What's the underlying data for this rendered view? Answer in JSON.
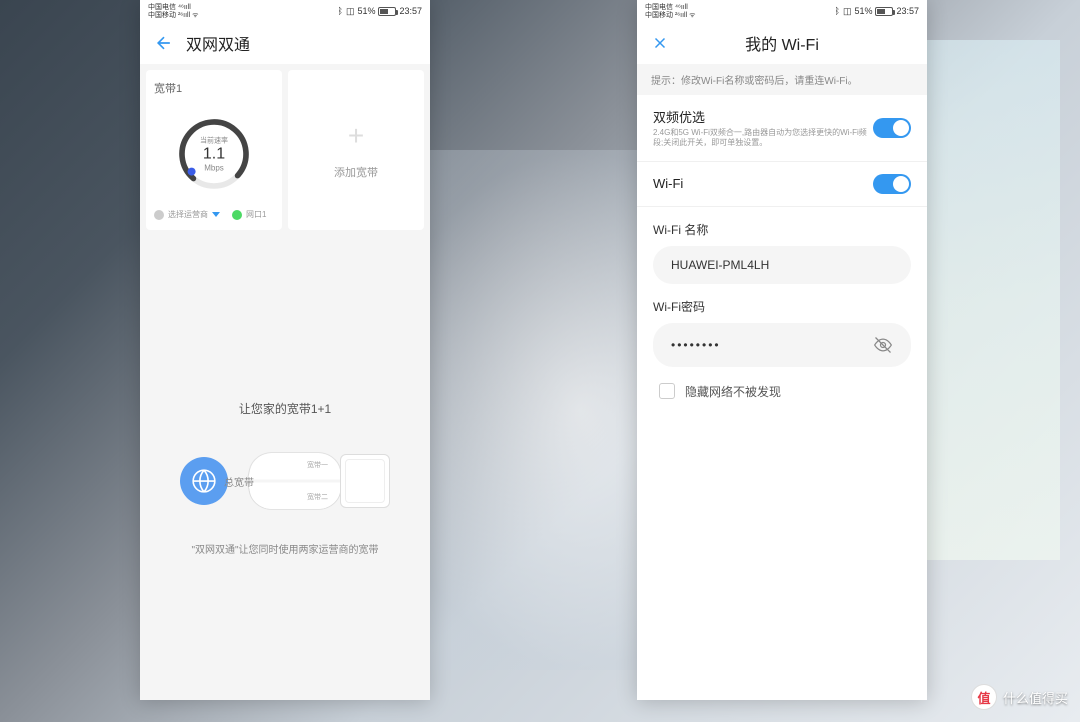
{
  "status": {
    "carrier1": "中国电信 ⁴⁶ııll",
    "carrier2": "中国移动 ²⁶ııll ᯤ",
    "bluetooth": "ᛒ",
    "vibrate": "◫",
    "battery": "51%",
    "time": "23:57"
  },
  "left": {
    "title": "双网双通",
    "card1": {
      "title": "宽带1",
      "gauge_label": "当前速率",
      "gauge_value": "1.1",
      "gauge_unit": "Mbps",
      "footer_carrier": "选择运营商",
      "footer_port": "网口1"
    },
    "card2": {
      "add_label": "添加宽带"
    },
    "promo": {
      "title": "让您家的宽带1+1",
      "total_label": "总宽带",
      "line1_label": "宽带一",
      "line2_label": "宽带二",
      "desc": "\"双网双通\"让您同时使用两家运营商的宽带"
    }
  },
  "right": {
    "title": "我的 Wi-Fi",
    "hint": "提示：修改Wi-Fi名称或密码后，请重连Wi-Fi。",
    "dual_band": {
      "title": "双频优选",
      "desc": "2.4G和5G Wi-Fi双频合一,路由器自动为您选择更快的Wi-Fi频段;关闭此开关，即可单独设置。"
    },
    "wifi_label": "Wi-Fi",
    "name_label": "Wi-Fi 名称",
    "name_value": "HUAWEI-PML4LH",
    "pwd_label": "Wi-Fi密码",
    "pwd_value": "••••••••",
    "hide_label": "隐藏网络不被发现"
  },
  "watermark": {
    "badge": "值",
    "text": "什么值得买"
  }
}
